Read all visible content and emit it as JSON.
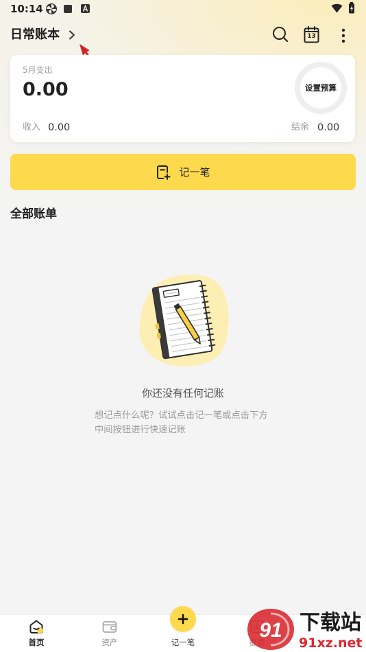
{
  "status_bar": {
    "time": "10:14",
    "icons": [
      "pinwheel-icon",
      "square-icon",
      "a-letter-icon",
      "wifi-icon",
      "battery-charging-icon"
    ]
  },
  "header": {
    "ledger_name": "日常账本",
    "calendar_day": "13",
    "icons": [
      "chevron-right-icon",
      "search-icon",
      "calendar-icon",
      "more-vertical-icon"
    ]
  },
  "annotation": {
    "icon": "red-arrow-icon",
    "color": "#d62424"
  },
  "summary": {
    "expense_label": "5月支出",
    "expense_amount": "0.00",
    "budget_label": "设置预算",
    "income_label": "收入",
    "income_amount": "0.00",
    "balance_label": "结余",
    "balance_amount": "0.00"
  },
  "record_button": {
    "label": "记一笔",
    "icon": "add-record-icon"
  },
  "bills": {
    "title": "全部账单",
    "illustration_icon": "notebook-pencil-icon",
    "empty_title": "你还没有任何记账",
    "empty_desc_lines": [
      "想记点什么呢？试试点击记一笔或点击下方",
      "中间按钮进行快速记账"
    ]
  },
  "bottom_nav": {
    "items": [
      {
        "label": "首页",
        "icon": "home-icon",
        "active": true
      },
      {
        "label": "资产",
        "icon": "wallet-icon",
        "active": false
      },
      {
        "label": "记一笔",
        "icon": "plus-icon",
        "active": false
      },
      {
        "label": "报表",
        "icon": "report-icon",
        "active": false
      }
    ]
  },
  "watermark": {
    "logo_text": "91",
    "title": "下载站",
    "site": "91xz.net"
  },
  "colors": {
    "accent": "#fdd94d",
    "background": "#f4f4f4",
    "card": "#ffffff",
    "text": "#222222",
    "muted": "#9a9a9a",
    "annotation": "#d62424",
    "watermark": "#e0262f"
  }
}
